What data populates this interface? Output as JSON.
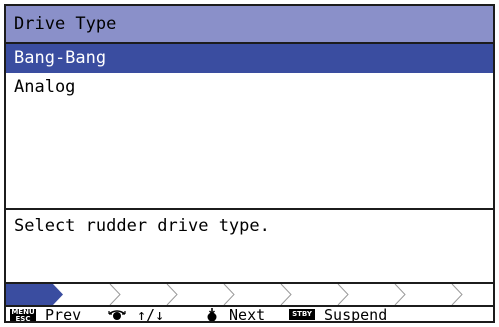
{
  "dialog": {
    "title": "Drive Type",
    "options": [
      {
        "label": "Bang-Bang",
        "selected": true
      },
      {
        "label": "Analog",
        "selected": false
      }
    ],
    "description": "Select rudder drive type."
  },
  "progress": {
    "current_step": 1,
    "total_steps": 11
  },
  "footer": {
    "menu_badge": "MENU ESC",
    "prev_label": "Prev",
    "dial_label": "↑/↓",
    "next_label": "Next",
    "stby_badge": "STBY",
    "suspend_label": "Suspend"
  },
  "colors": {
    "title_bg": "#8a90c9",
    "selected_bg": "#3a4da0",
    "progress_fill": "#3a4da0",
    "border": "#1c1c1c"
  },
  "icons": {
    "menu": "menu-esc-key-icon",
    "dial": "rotary-knob-icon",
    "next": "knob-push-icon",
    "stby": "stby-key-icon"
  }
}
